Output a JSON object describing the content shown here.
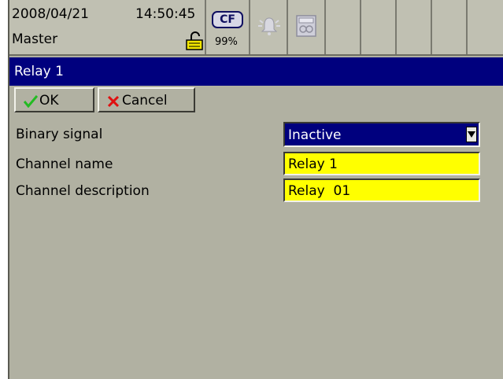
{
  "status": {
    "date": "2008/04/21",
    "time": "14:50:45",
    "user": "Master",
    "storage_label": "CF",
    "storage_percent": "99%",
    "icons": [
      "lock-icon",
      "cf-card-icon",
      "alarm-icon",
      "counter-icon"
    ]
  },
  "title": "Relay 1",
  "buttons": {
    "ok": "OK",
    "cancel": "Cancel"
  },
  "form": {
    "binary_signal": {
      "label": "Binary signal",
      "value": "Inactive"
    },
    "channel_name": {
      "label": "Channel name",
      "value": "Relay 1"
    },
    "channel_description": {
      "label": "Channel description",
      "value": "Relay  01"
    }
  },
  "colors": {
    "background": "#b1b1a2",
    "title_bar": "#00007e",
    "field_highlight": "#ffff00",
    "ok_check": "#22bb22",
    "cancel_x": "#e01010"
  }
}
